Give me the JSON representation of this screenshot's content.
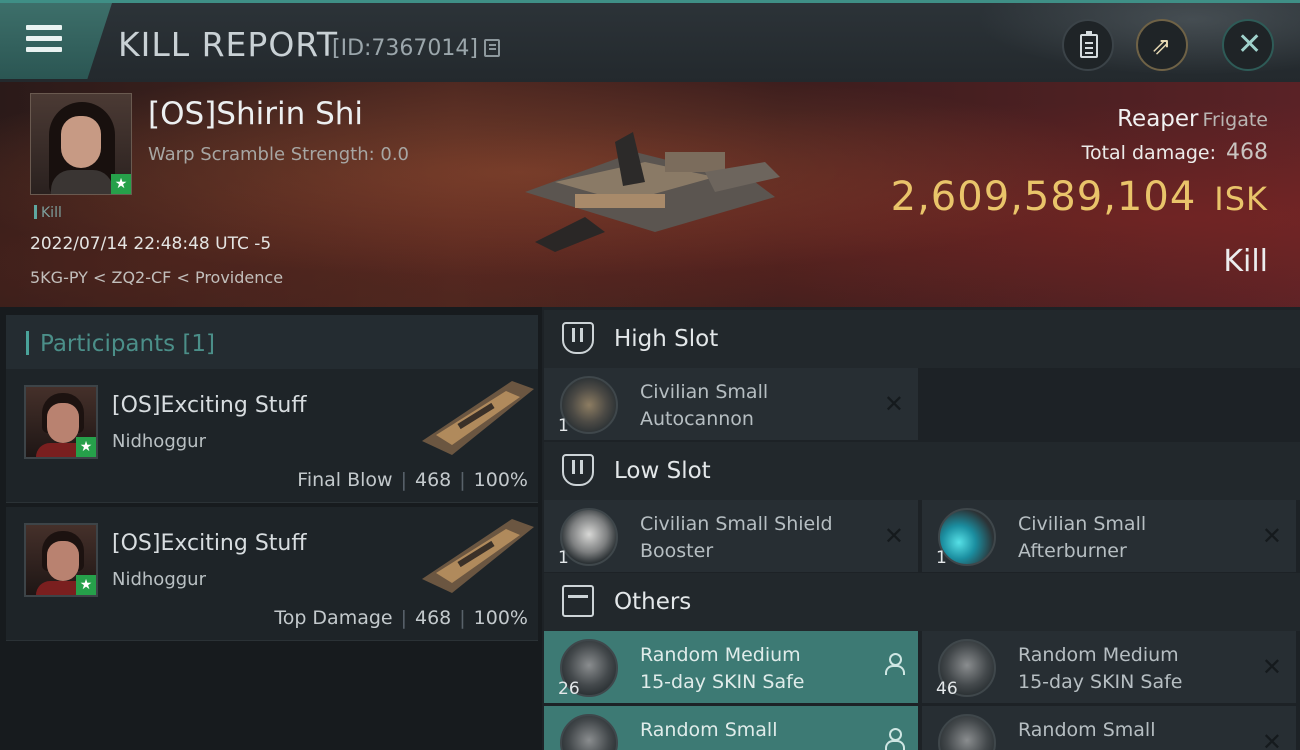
{
  "header": {
    "title": "KILL REPORT",
    "report_id": "[ID:7367014]"
  },
  "victim": {
    "name": "[OS]Shirin Shi",
    "warp_scramble": "Warp Scramble Strength: 0.0",
    "tag": "Kill",
    "datetime": "2022/07/14 22:48:48 UTC -5",
    "location": "5KG-PY < ZQ2-CF < Providence",
    "ship": "Reaper",
    "ship_class": "Frigate",
    "total_damage_label": "Total damage:",
    "total_damage": "468",
    "isk_value": "2,609,589,104",
    "isk_unit": "ISK",
    "result": "Kill"
  },
  "participants": {
    "header": "Participants [1]",
    "rows": [
      {
        "name": "[OS]Exciting Stuff",
        "ship": "Nidhoggur",
        "role": "Final Blow",
        "damage": "468",
        "percent": "100%"
      },
      {
        "name": "[OS]Exciting Stuff",
        "ship": "Nidhoggur",
        "role": "Top Damage",
        "damage": "468",
        "percent": "100%"
      }
    ]
  },
  "fittings": {
    "high_slot": {
      "label": "High Slot",
      "items": [
        {
          "name_l1": "Civilian Small",
          "name_l2": "Autocannon",
          "qty": "1",
          "icon": "autocannon-icon"
        }
      ]
    },
    "low_slot": {
      "label": "Low Slot",
      "items": [
        {
          "name_l1": "Civilian Small Shield",
          "name_l2": "Booster",
          "qty": "1",
          "icon": "shield-booster-icon"
        },
        {
          "name_l1": "Civilian Small",
          "name_l2": "Afterburner",
          "qty": "1",
          "icon": "afterburner-icon"
        }
      ]
    },
    "others": {
      "label": "Others",
      "items": [
        {
          "name_l1": "Random Medium",
          "name_l2": "15-day SKIN Safe",
          "qty": "26",
          "icon": "skin-safe-icon",
          "highlighted": true
        },
        {
          "name_l1": "Random Medium",
          "name_l2": "15-day SKIN Safe",
          "qty": "46",
          "icon": "skin-safe-icon"
        },
        {
          "name_l1": "Random Small",
          "name_l2": "",
          "qty": "",
          "icon": "skin-safe-icon",
          "highlighted": true
        },
        {
          "name_l1": "Random Small",
          "name_l2": "",
          "qty": "",
          "icon": "skin-safe-icon"
        }
      ]
    }
  },
  "colors": {
    "accent_teal": "#3d7a74",
    "isk_gold": "#e9c46a",
    "corp_badge_green": "#26a04a"
  }
}
